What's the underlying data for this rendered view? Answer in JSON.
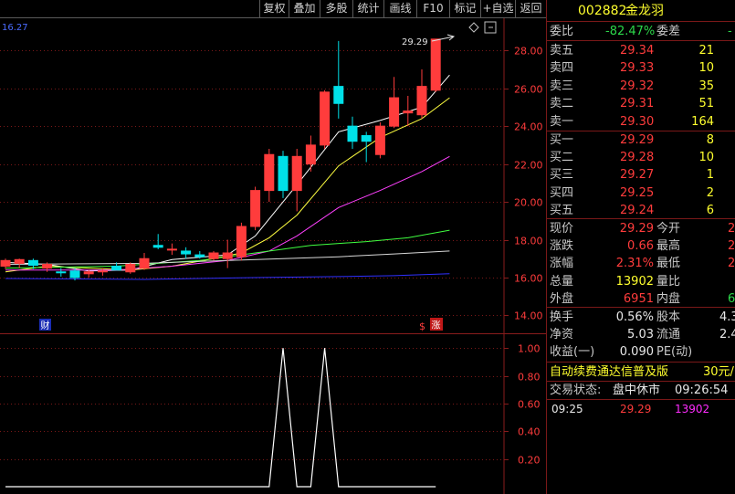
{
  "toolbar": {
    "buttons": [
      "复权",
      "叠加",
      "多股",
      "统计",
      "画线",
      "F10",
      "标记",
      "+自选",
      "返回"
    ]
  },
  "chart": {
    "corner_value": "16.27",
    "high_marker": "29.29",
    "y_ticks": [
      "28.00",
      "26.00",
      "24.00",
      "22.00",
      "20.00",
      "18.00",
      "16.00",
      "14.00"
    ],
    "sub_ticks": [
      "1.00",
      "0.80",
      "0.60",
      "0.40",
      "0.20"
    ],
    "badge_cai": "财",
    "badge_zhang": "涨",
    "badge_s": "$",
    "colors": {
      "up": "#ff3c3c",
      "down": "#00e0e8",
      "ma5": "#ffffff",
      "ma10": "#ffff40",
      "ma20": "#ff40ff",
      "ma60": "#40ff40",
      "ma120": "#d8d8d8",
      "ma250": "#3030ff"
    }
  },
  "chart_data": {
    "type": "candlestick",
    "ylim": [
      13.2,
      29.7
    ],
    "grid": true,
    "candles": [
      {
        "o": 16.6,
        "h": 17.0,
        "l": 16.45,
        "c": 16.9
      },
      {
        "o": 16.75,
        "h": 17.0,
        "l": 16.5,
        "c": 16.95
      },
      {
        "o": 16.9,
        "h": 17.0,
        "l": 16.45,
        "c": 16.65
      },
      {
        "o": 16.5,
        "h": 16.8,
        "l": 16.3,
        "c": 16.7
      },
      {
        "o": 16.3,
        "h": 16.5,
        "l": 16.05,
        "c": 16.25
      },
      {
        "o": 16.35,
        "h": 16.5,
        "l": 15.85,
        "c": 16.0
      },
      {
        "o": 16.2,
        "h": 16.4,
        "l": 16.0,
        "c": 16.3
      },
      {
        "o": 16.3,
        "h": 16.5,
        "l": 16.1,
        "c": 16.35
      },
      {
        "o": 16.6,
        "h": 16.8,
        "l": 16.5,
        "c": 16.4
      },
      {
        "o": 16.3,
        "h": 16.8,
        "l": 16.2,
        "c": 16.7
      },
      {
        "o": 16.5,
        "h": 17.3,
        "l": 16.4,
        "c": 17.0
      },
      {
        "o": 17.7,
        "h": 18.3,
        "l": 17.5,
        "c": 17.6
      },
      {
        "o": 17.5,
        "h": 17.8,
        "l": 17.2,
        "c": 17.5
      },
      {
        "o": 17.4,
        "h": 17.6,
        "l": 17.0,
        "c": 17.25
      },
      {
        "o": 17.2,
        "h": 17.4,
        "l": 17.0,
        "c": 17.1
      },
      {
        "o": 17.0,
        "h": 17.4,
        "l": 16.9,
        "c": 17.3
      },
      {
        "o": 17.0,
        "h": 18.0,
        "l": 16.5,
        "c": 17.3
      },
      {
        "o": 17.1,
        "h": 18.9,
        "l": 16.9,
        "c": 18.7
      },
      {
        "o": 18.7,
        "h": 20.8,
        "l": 18.5,
        "c": 20.6
      },
      {
        "o": 20.6,
        "h": 22.8,
        "l": 20.0,
        "c": 22.5
      },
      {
        "o": 22.4,
        "h": 22.7,
        "l": 20.2,
        "c": 20.6
      },
      {
        "o": 20.6,
        "h": 22.8,
        "l": 19.5,
        "c": 22.4
      },
      {
        "o": 22.0,
        "h": 23.5,
        "l": 21.6,
        "c": 23.0
      },
      {
        "o": 23.0,
        "h": 25.9,
        "l": 22.8,
        "c": 25.8
      },
      {
        "o": 26.1,
        "h": 28.5,
        "l": 24.4,
        "c": 25.2
      },
      {
        "o": 24.0,
        "h": 24.5,
        "l": 22.8,
        "c": 23.2
      },
      {
        "o": 23.5,
        "h": 23.7,
        "l": 22.1,
        "c": 23.2
      },
      {
        "o": 22.5,
        "h": 24.2,
        "l": 22.3,
        "c": 24.0
      },
      {
        "o": 24.0,
        "h": 26.6,
        "l": 23.9,
        "c": 25.5
      },
      {
        "o": 24.7,
        "h": 25.6,
        "l": 24.0,
        "c": 24.8
      },
      {
        "o": 24.6,
        "h": 27.0,
        "l": 24.4,
        "c": 26.1
      },
      {
        "o": 25.9,
        "h": 28.6,
        "l": 25.8,
        "c": 28.6
      }
    ],
    "ma": [
      {
        "color": "#ffffff",
        "points": [
          [
            0,
            16.8
          ],
          [
            3,
            16.7
          ],
          [
            6,
            16.35
          ],
          [
            9,
            16.4
          ],
          [
            12,
            16.95
          ],
          [
            16,
            17.2
          ],
          [
            18,
            18.2
          ],
          [
            21,
            20.9
          ],
          [
            24,
            23.7
          ],
          [
            27,
            24.3
          ],
          [
            30,
            25.0
          ],
          [
            32,
            26.7
          ]
        ]
      },
      {
        "color": "#ffff40",
        "points": [
          [
            0,
            16.3
          ],
          [
            3,
            16.6
          ],
          [
            6,
            16.5
          ],
          [
            9,
            16.4
          ],
          [
            12,
            16.6
          ],
          [
            15,
            17.0
          ],
          [
            17,
            17.3
          ],
          [
            19,
            18.1
          ],
          [
            21,
            19.3
          ],
          [
            24,
            21.9
          ],
          [
            27,
            23.4
          ],
          [
            30,
            24.4
          ],
          [
            32,
            25.5
          ]
        ]
      },
      {
        "color": "#ff40ff",
        "points": [
          [
            0,
            16.4
          ],
          [
            4,
            16.4
          ],
          [
            8,
            16.4
          ],
          [
            12,
            16.6
          ],
          [
            16,
            16.9
          ],
          [
            19,
            17.4
          ],
          [
            21,
            18.2
          ],
          [
            24,
            19.7
          ],
          [
            27,
            20.6
          ],
          [
            30,
            21.6
          ],
          [
            32,
            22.4
          ]
        ]
      },
      {
        "color": "#40ff40",
        "points": [
          [
            0,
            16.5
          ],
          [
            8,
            16.6
          ],
          [
            14,
            16.9
          ],
          [
            18,
            17.3
          ],
          [
            22,
            17.7
          ],
          [
            26,
            17.9
          ],
          [
            29,
            18.1
          ],
          [
            32,
            18.5
          ]
        ]
      },
      {
        "color": "#d8d8d8",
        "points": [
          [
            0,
            16.7
          ],
          [
            10,
            16.75
          ],
          [
            16,
            16.9
          ],
          [
            20,
            17.0
          ],
          [
            24,
            17.1
          ],
          [
            28,
            17.25
          ],
          [
            32,
            17.4
          ]
        ]
      },
      {
        "color": "#3030ff",
        "points": [
          [
            0,
            15.95
          ],
          [
            10,
            15.9
          ],
          [
            18,
            16.0
          ],
          [
            24,
            16.05
          ],
          [
            28,
            16.1
          ],
          [
            32,
            16.2
          ]
        ]
      }
    ],
    "sub_ylim": [
      0,
      1.1
    ],
    "sub_series": [
      0,
      0,
      0,
      0,
      0,
      0,
      0,
      0,
      0,
      0,
      0,
      0,
      0,
      0,
      0,
      0,
      0,
      0,
      0,
      0,
      1,
      0,
      0,
      1,
      0,
      0,
      0,
      0,
      0,
      0,
      0,
      0
    ]
  },
  "side": {
    "code": "002882",
    "name": "金龙羽",
    "ratio_label": "委比",
    "ratio_value": "-82.47%",
    "diff_label": "委差",
    "diff_value": "-",
    "asks": [
      {
        "label": "卖五",
        "price": "29.34",
        "vol": "21"
      },
      {
        "label": "卖四",
        "price": "29.33",
        "vol": "10"
      },
      {
        "label": "卖三",
        "price": "29.32",
        "vol": "35"
      },
      {
        "label": "卖二",
        "price": "29.31",
        "vol": "51"
      },
      {
        "label": "卖一",
        "price": "29.30",
        "vol": "164"
      }
    ],
    "bids": [
      {
        "label": "买一",
        "price": "29.29",
        "vol": "8"
      },
      {
        "label": "买二",
        "price": "29.28",
        "vol": "10"
      },
      {
        "label": "买三",
        "price": "29.27",
        "vol": "1"
      },
      {
        "label": "买四",
        "price": "29.25",
        "vol": "2"
      },
      {
        "label": "买五",
        "price": "29.24",
        "vol": "6"
      }
    ],
    "quote": [
      {
        "l1": "现价",
        "v1": "29.29",
        "c1": "red",
        "l2": "今开",
        "v2": "2",
        "c2": "red"
      },
      {
        "l1": "涨跌",
        "v1": "0.66",
        "c1": "red",
        "l2": "最高",
        "v2": "2",
        "c2": "red"
      },
      {
        "l1": "涨幅",
        "v1": "2.31%",
        "c1": "red",
        "l2": "最低",
        "v2": "2",
        "c2": "red"
      },
      {
        "l1": "总量",
        "v1": "13902",
        "c1": "yel",
        "l2": "量比",
        "v2": "",
        "c2": "yel"
      },
      {
        "l1": "外盘",
        "v1": "6951",
        "c1": "red",
        "l2": "内盘",
        "v2": "6",
        "c2": "grn"
      }
    ],
    "finance": [
      {
        "l1": "换手",
        "v1": "0.56%",
        "l2": "股本",
        "v2": "4.3"
      },
      {
        "l1": "净资",
        "v1": "5.03",
        "l2": "流通",
        "v2": "2.4"
      },
      {
        "l1": "收益(一)",
        "v1": "0.090",
        "l2": "PE(动)",
        "v2": ""
      }
    ],
    "promo": "自动续费通达信普及版",
    "promo_price": "30元/",
    "status_label": "交易状态:",
    "status_value": "盘中休市",
    "status_time": "09:26:54",
    "tick": {
      "time": "09:25",
      "price": "29.29",
      "vol": "13902"
    }
  }
}
